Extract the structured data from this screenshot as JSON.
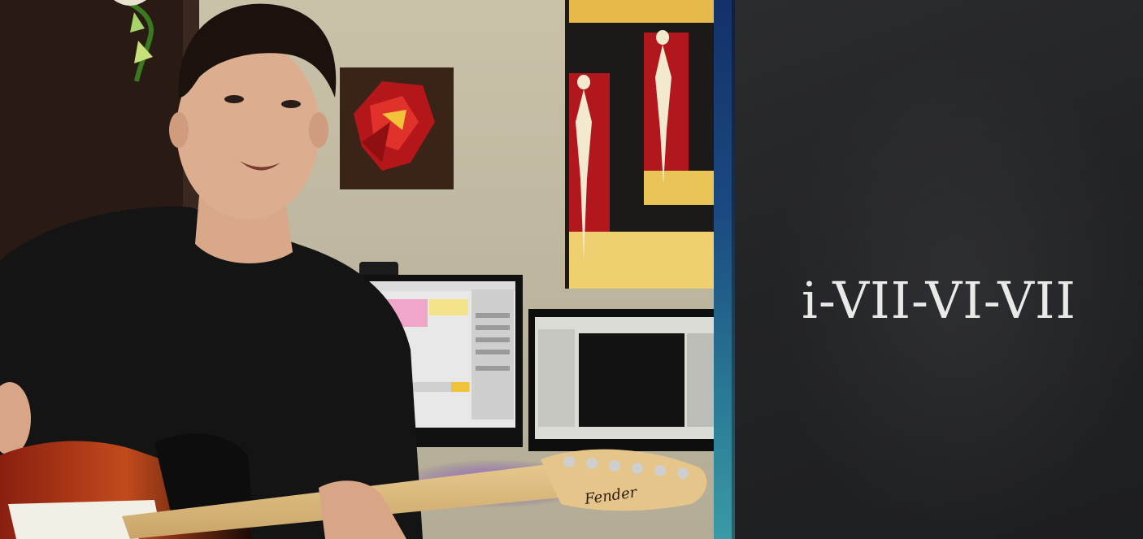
{
  "title_card": {
    "progression": "i-VII-VI-VII"
  },
  "scene": {
    "subject": "person-with-electric-guitar",
    "guitar_headstock_text": "Fender"
  },
  "colors": {
    "panel_background": "#242528",
    "panel_text": "#e9e9e7",
    "divider_top": "#14306a",
    "divider_bottom": "#3a9aa6"
  }
}
